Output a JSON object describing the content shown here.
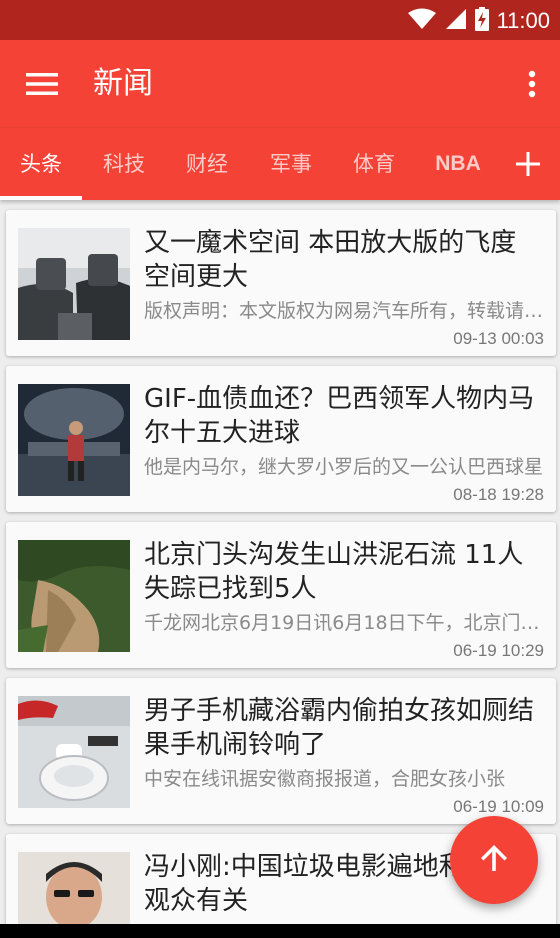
{
  "status_bar": {
    "time": "11:00",
    "icons": [
      "wifi-icon",
      "signal-icon",
      "battery-charging-icon"
    ]
  },
  "app_bar": {
    "title": "新闻",
    "menu_icon": "hamburger-menu-icon",
    "more_icon": "more-vert-icon"
  },
  "tabs": [
    {
      "label": "头条",
      "active": true
    },
    {
      "label": "科技",
      "active": false
    },
    {
      "label": "财经",
      "active": false
    },
    {
      "label": "军事",
      "active": false
    },
    {
      "label": "体育",
      "active": false
    },
    {
      "label": "NBA",
      "active": false
    }
  ],
  "add_tab_icon": "plus-icon",
  "news": [
    {
      "title": "又一魔术空间 本田放大版的飞度空间更大",
      "summary": "版权声明：本文版权为网易汽车所有，转载请注明出处。",
      "time": "09-13 00:03",
      "image": "car-interior"
    },
    {
      "title": "GIF-血债血还？巴西领军人物内马尔十五大进球",
      "summary": "他是内马尔，继大罗小罗后的又一公认巴西球星",
      "time": "08-18 19:28",
      "image": "soccer-player"
    },
    {
      "title": "北京门头沟发生山洪泥石流 11人失踪已找到5人",
      "summary": "千龙网北京6月19日讯6月18日下午，北京门头沟",
      "time": "06-19 10:29",
      "image": "landslide"
    },
    {
      "title": "男子手机藏浴霸内偷拍女孩如厕结果手机闹铃响了",
      "summary": "中安在线讯据安徽商报报道，合肥女孩小张",
      "time": "06-19 10:09",
      "image": "toilet"
    },
    {
      "title": "冯小刚:中国垃圾电影遍地和垃圾观众有关",
      "summary": "",
      "time": "",
      "image": "man-portrait"
    }
  ],
  "fab_icon": "arrow-up-icon",
  "colors": {
    "primary": "#f44236",
    "status_bar": "#b0261f",
    "background": "#ededed"
  }
}
